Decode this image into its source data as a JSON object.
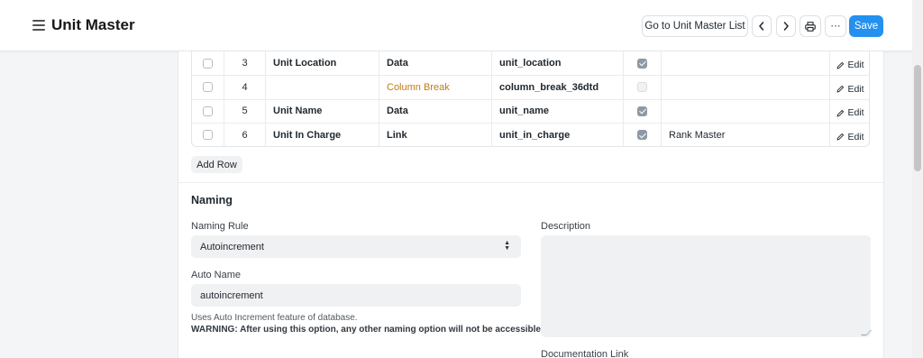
{
  "header": {
    "title": "Unit Master",
    "go_to_list": "Go to Unit Master List",
    "save": "Save",
    "more": "···"
  },
  "grid": {
    "rows": [
      {
        "idx": "3",
        "label": "Unit Location",
        "type": "Data",
        "fieldname": "unit_location",
        "mandatory": true,
        "options": ""
      },
      {
        "idx": "4",
        "label": "",
        "type": "Column Break",
        "fieldname": "column_break_36dtd",
        "mandatory": false,
        "options": ""
      },
      {
        "idx": "5",
        "label": "Unit Name",
        "type": "Data",
        "fieldname": "unit_name",
        "mandatory": true,
        "options": ""
      },
      {
        "idx": "6",
        "label": "Unit In Charge",
        "type": "Link",
        "fieldname": "unit_in_charge",
        "mandatory": true,
        "options": "Rank Master"
      }
    ],
    "edit_label": "Edit",
    "add_row": "Add Row"
  },
  "naming": {
    "section_title": "Naming",
    "naming_rule_label": "Naming Rule",
    "naming_rule_value": "Autoincrement",
    "auto_name_label": "Auto Name",
    "auto_name_value": "autoincrement",
    "help_text": "Uses Auto Increment feature of database.",
    "warning_text": "WARNING: After using this option, any other naming option will not be accessible.",
    "description_label": "Description",
    "documentation_link_label": "Documentation Link"
  },
  "icons": {
    "menu": "hamburger-icon",
    "prev": "chevron-left-icon",
    "next": "chevron-right-icon",
    "print": "printer-icon",
    "edit": "pencil-icon"
  },
  "colors": {
    "primary": "#2490ef",
    "column_break": "#c07c16"
  }
}
